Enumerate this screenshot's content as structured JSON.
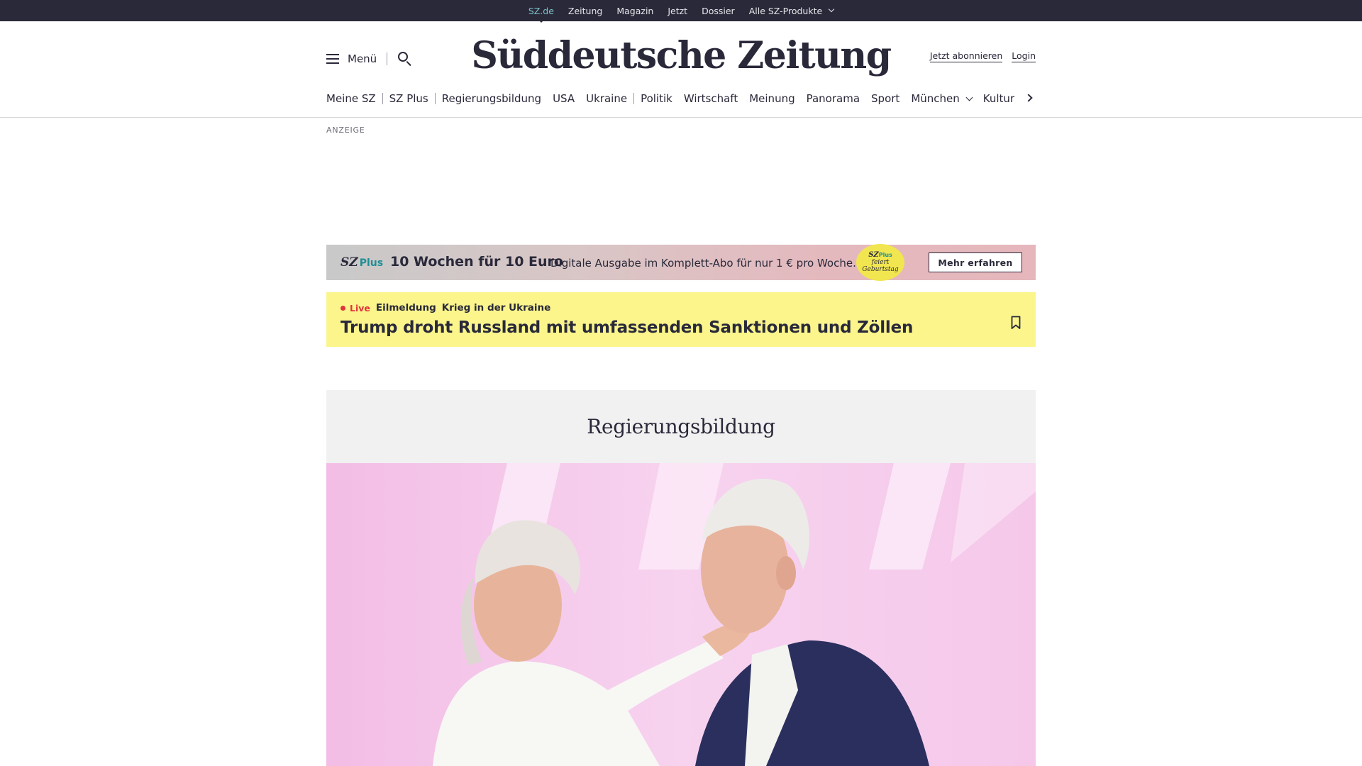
{
  "topbar": {
    "items": [
      "SZ.de",
      "Zeitung",
      "Magazin",
      "Jetzt",
      "Dossier",
      "Alle SZ-Produkte"
    ]
  },
  "header": {
    "menu_label": "Menü",
    "logo": "Süddeutsche Zeitung",
    "subscribe_label": "Jetzt abonnieren",
    "login_label": "Login"
  },
  "nav": {
    "items": [
      "Meine SZ",
      "SZ Plus",
      "Regierungsbildung",
      "USA",
      "Ukraine",
      "Politik",
      "Wirtschaft",
      "Meinung",
      "Panorama",
      "Sport",
      "München",
      "Kultur"
    ]
  },
  "ad": {
    "label": "ANZEIGE"
  },
  "promo": {
    "logo_sz": "SZ",
    "logo_plus": "Plus",
    "headline": "10 Wochen für 10 Euro",
    "text": "Digitale Ausgabe im Komplett-Abo für nur 1 € pro Woche.",
    "badge_sz": "SZ",
    "badge_plus": "Plus",
    "badge_line1": "feiert",
    "badge_line2": "Geburtstag",
    "button_label": "Mehr erfahren"
  },
  "breaking": {
    "live_label": "Live",
    "kicker": "Eilmeldung",
    "topic": "Krieg in der Ukraine",
    "title": "Trump droht Russland mit umfassenden Sanktionen und Zöllen"
  },
  "section": {
    "title": "Regierungsbildung"
  },
  "colors": {
    "brand_dark": "#29293a",
    "accent_teal": "#1f8f95",
    "live_red": "#e1333b",
    "breaking_yellow": "#fbf58c"
  }
}
